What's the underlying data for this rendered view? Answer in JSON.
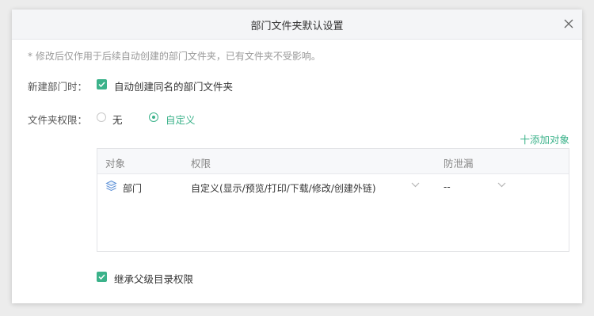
{
  "dialog": {
    "title": "部门文件夹默认设置",
    "hint": "*  修改后仅作用于后续自动创建的部门文件夹，已有文件夹不受影响。"
  },
  "new_dept": {
    "label": "新建部门时：",
    "checkbox_label": "自动创建同名的部门文件夹",
    "checked": true
  },
  "folder_permission": {
    "label": "文件夹权限：",
    "options": [
      "无",
      "自定义"
    ],
    "selected": "自定义"
  },
  "add_object_link": "十添加对象",
  "table": {
    "headers": [
      "对象",
      "权限",
      "防泄漏"
    ],
    "rows": [
      {
        "object": "部门",
        "permission": "自定义(显示/预览/打印/下载/修改/创建外链)",
        "leak_prevention": "--"
      }
    ]
  },
  "inherit": {
    "label": "继承父级目录权限",
    "checked": true
  },
  "colors": {
    "accent": "#3bb28a"
  },
  "icons": {
    "close": "close-icon",
    "department": "layers-icon",
    "dropdown": "chevron-down-icon",
    "check": "check-icon"
  }
}
